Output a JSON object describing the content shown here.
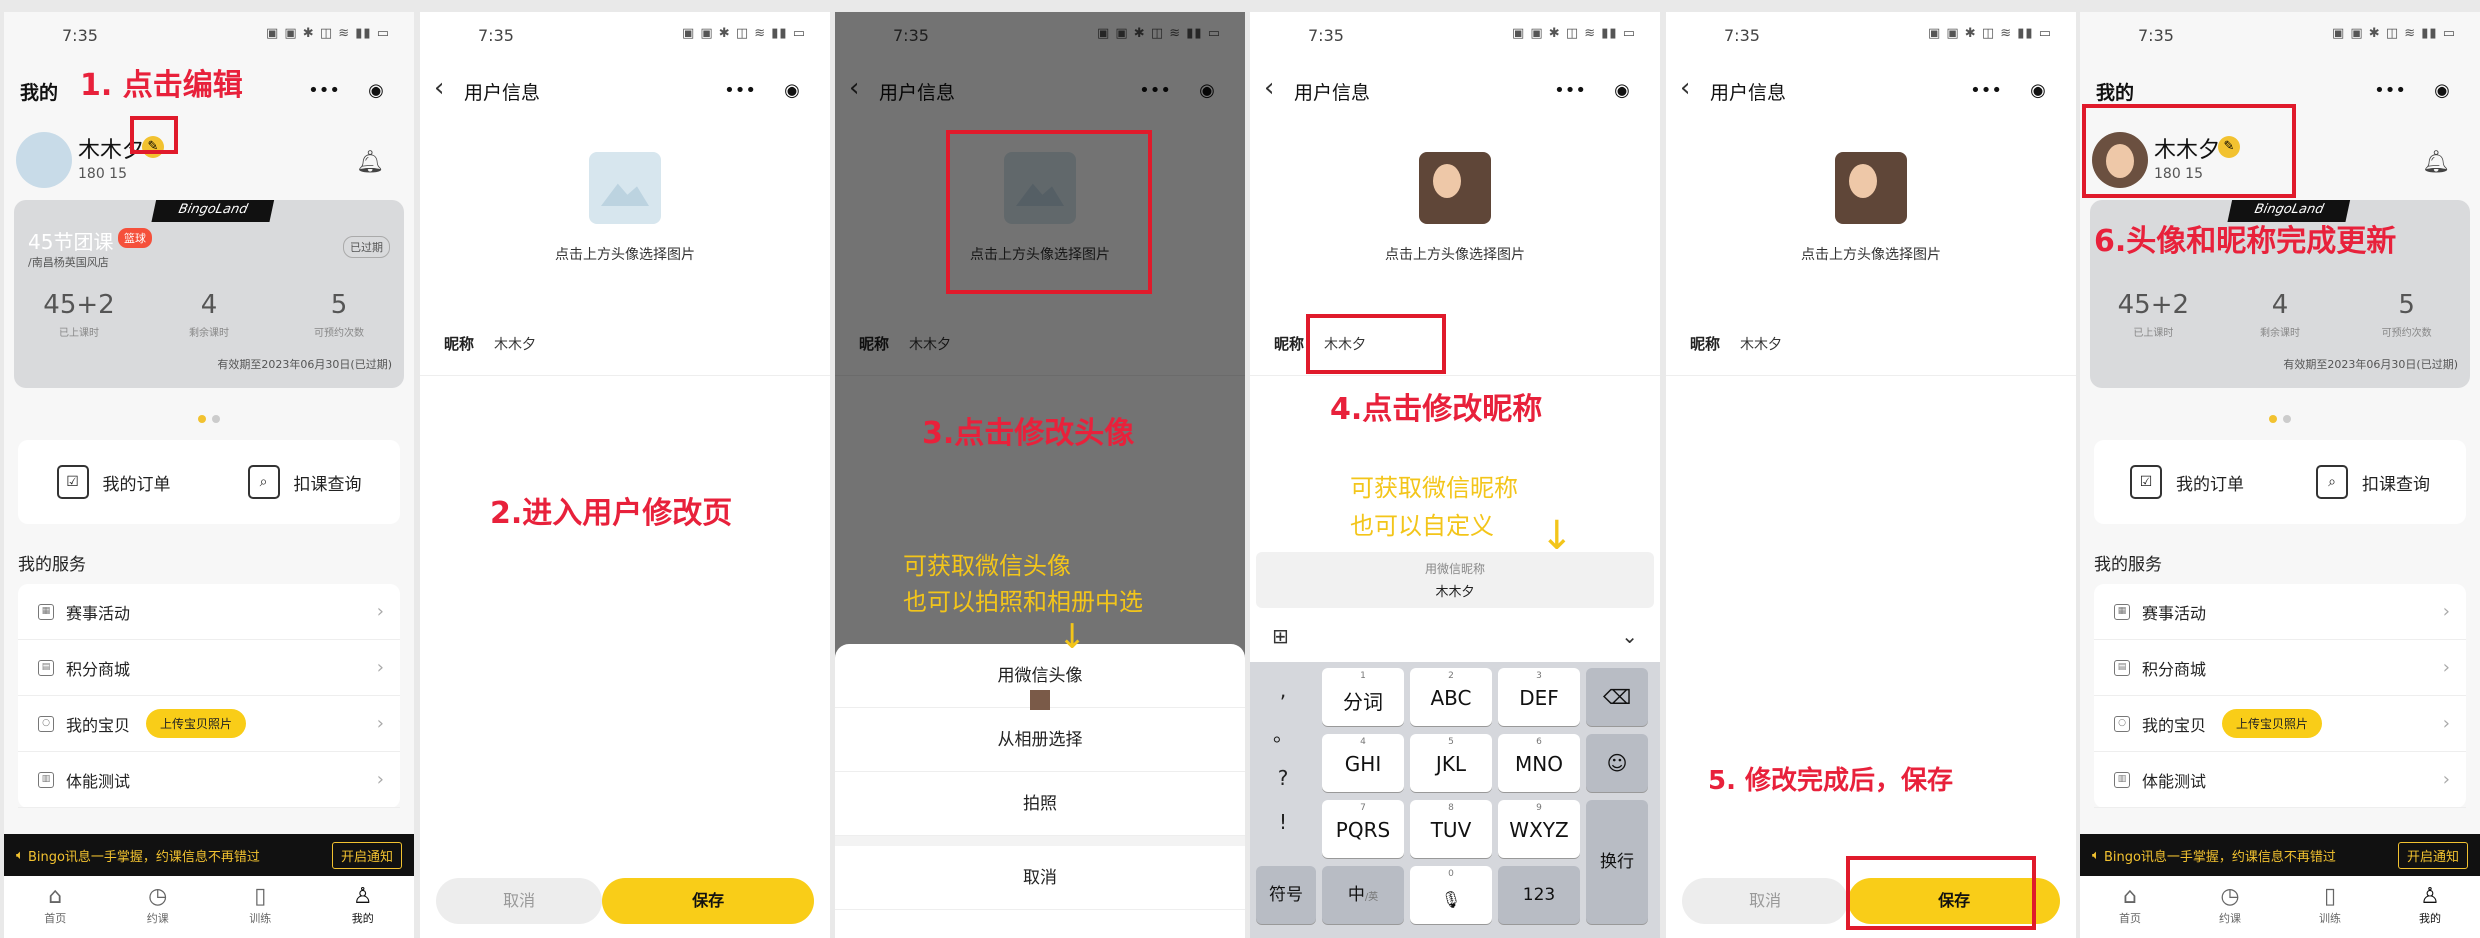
{
  "status": {
    "time": "7:35"
  },
  "p1": {
    "nav_title": "我的",
    "user": {
      "name": "木木夕",
      "phone": "180 15"
    },
    "card": {
      "tag": "BingoLand",
      "title": "45节团课",
      "badge": "篮球",
      "shop": "/南昌杨英国风店",
      "status": "已过期",
      "stats": [
        {
          "value": "45+2",
          "label": "已上课时"
        },
        {
          "value": "4",
          "label": "剩余课时"
        },
        {
          "value": "5",
          "label": "可预约次数"
        }
      ],
      "valid": "有效期至2023年06月30日(已过期)"
    },
    "quick": [
      {
        "label": "我的订单",
        "icon": "order-icon"
      },
      {
        "label": "扣课查询",
        "icon": "search-class-icon"
      }
    ],
    "services_title": "我的服务",
    "services": [
      {
        "label": "赛事活动"
      },
      {
        "label": "积分商城"
      },
      {
        "label": "我的宝贝",
        "button": "上传宝贝照片"
      },
      {
        "label": "体能测试"
      }
    ],
    "notice": {
      "text": "Bingo讯息一手掌握，约课信息不再错过",
      "button": "开启通知"
    },
    "tabs": [
      {
        "label": "首页",
        "icon": "home-icon"
      },
      {
        "label": "约课",
        "icon": "clock-icon"
      },
      {
        "label": "训练",
        "icon": "document-icon"
      },
      {
        "label": "我的",
        "icon": "user-icon"
      }
    ]
  },
  "user_info": {
    "title": "用户信息",
    "hint": "点击上方头像选择图片",
    "nick_label": "昵称",
    "nick_value": "木木夕",
    "cancel": "取消",
    "save": "保存"
  },
  "sheet": {
    "wechat": "用微信头像",
    "album": "从相册选择",
    "camera": "拍照",
    "cancel": "取消"
  },
  "keyboard": {
    "suggest_title": "用微信昵称",
    "suggest_value": "木木夕",
    "punct": [
      ",",
      "。",
      "?",
      "!"
    ],
    "keys": [
      {
        "num": "1",
        "label": "分词"
      },
      {
        "num": "2",
        "label": "ABC"
      },
      {
        "num": "3",
        "label": "DEF"
      },
      {
        "num": "4",
        "label": "GHI"
      },
      {
        "num": "5",
        "label": "JKL"
      },
      {
        "num": "6",
        "label": "MNO"
      },
      {
        "num": "7",
        "label": "PQRS"
      },
      {
        "num": "8",
        "label": "TUV"
      },
      {
        "num": "9",
        "label": "WXYZ"
      }
    ],
    "symbol": "符号",
    "zh": "中",
    "zh_sub": "/英",
    "space_num": "0",
    "n123": "123",
    "enter": "换行"
  },
  "annotations": {
    "a1": "1. 点击编辑",
    "a2": "2.进入用户修改页",
    "a3": "3.点击修改头像",
    "a3_note1": "可获取微信头像",
    "a3_note2": "也可以拍照和相册中选",
    "a4": "4.点击修改昵称",
    "a4_note1": "可获取微信昵称",
    "a4_note2": "也可以自定义",
    "a5": "5. 修改完成后，保存",
    "a6": "6.头像和昵称完成更新"
  },
  "colors": {
    "accent": "#f9cd18",
    "annotation": "#e8213b",
    "note": "#f3c51a"
  }
}
